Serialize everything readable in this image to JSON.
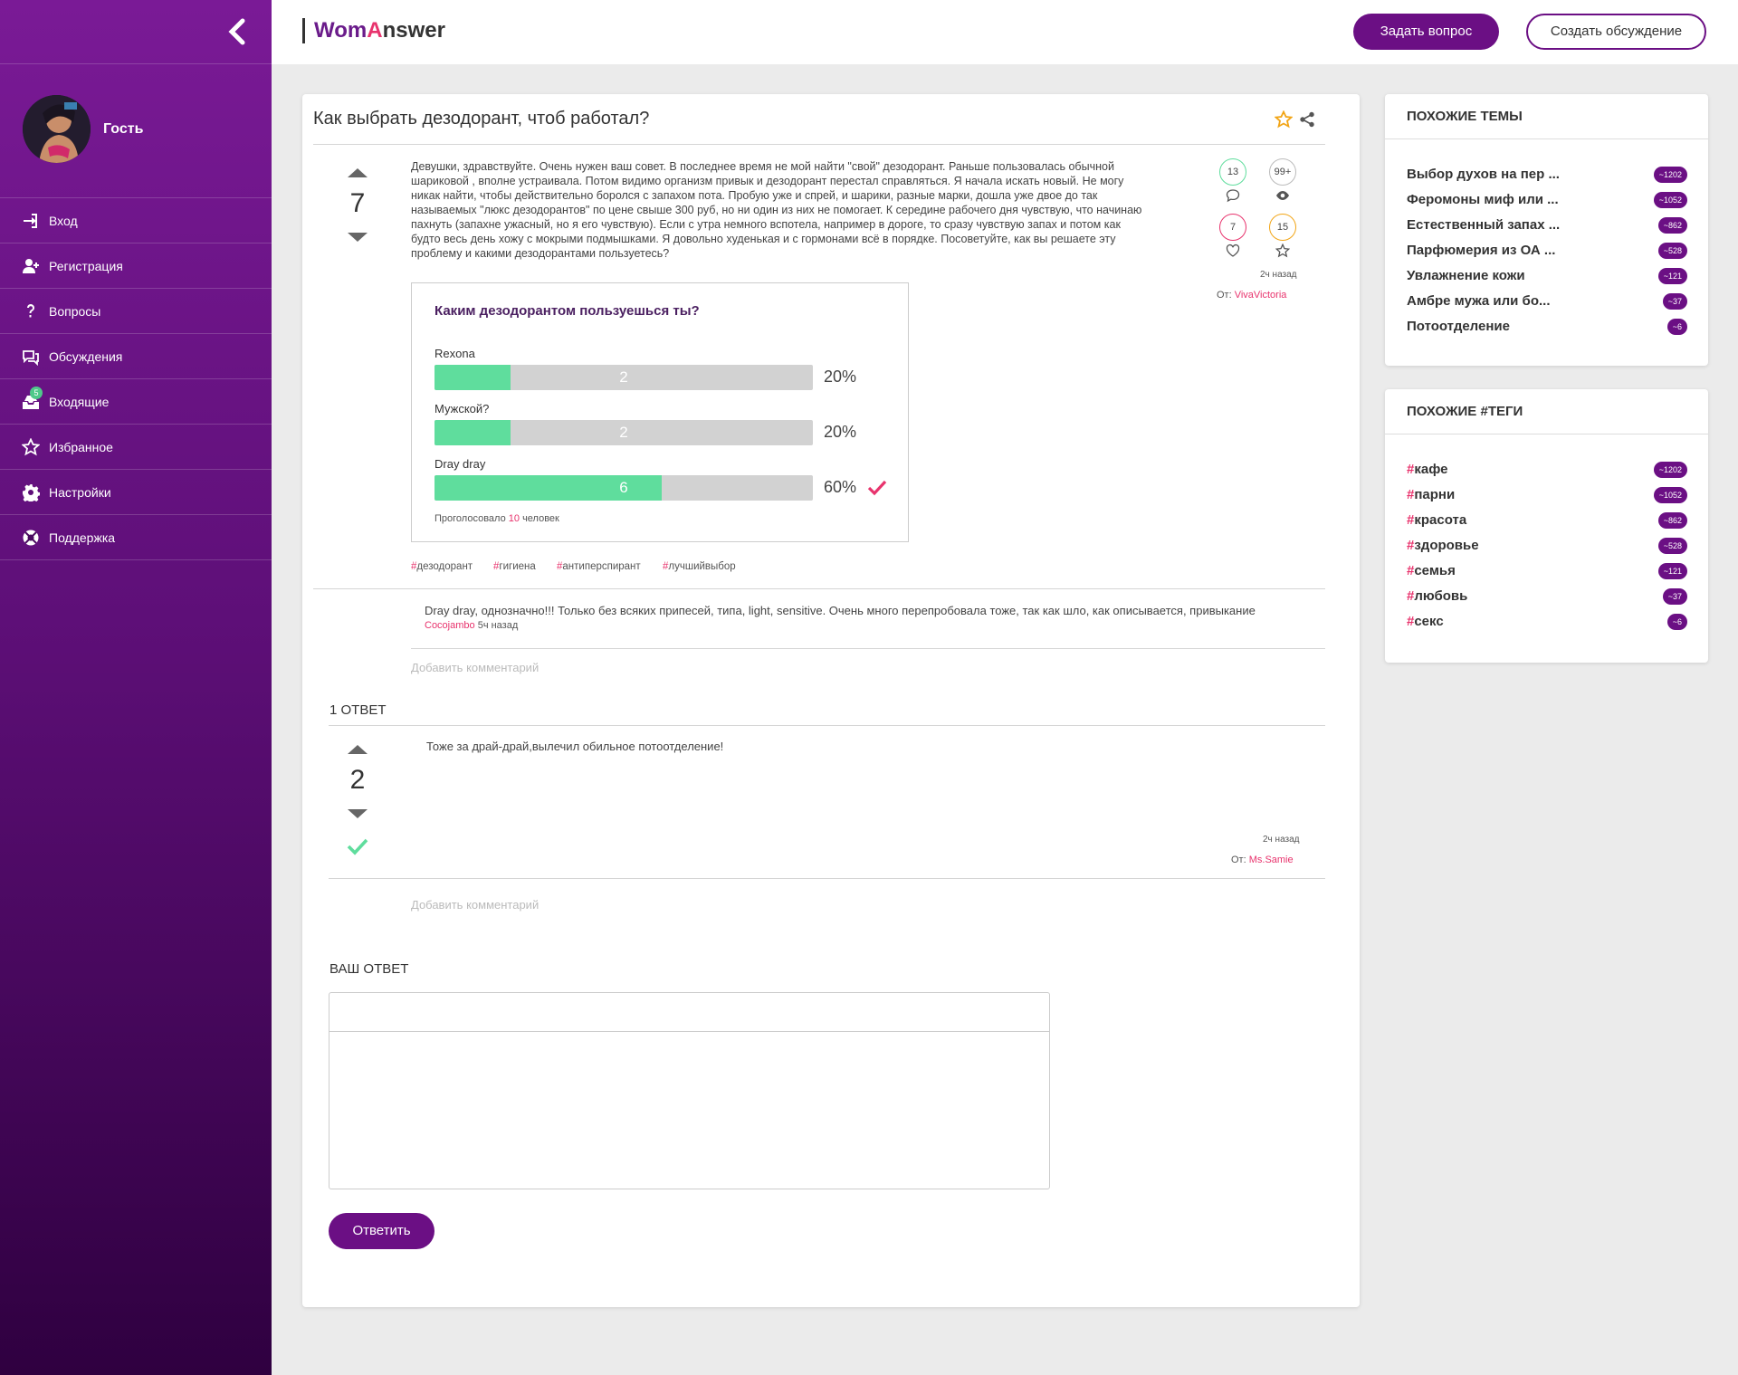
{
  "app": {
    "logo_part1": "Wom",
    "logo_part2": "A",
    "logo_part3": "nswer"
  },
  "header": {
    "ask_button": "Задать вопрос",
    "discuss_button": "Создать обсуждение"
  },
  "sidebar": {
    "user_name": "Гость",
    "items": [
      {
        "label": "Вход",
        "icon": "login-icon"
      },
      {
        "label": "Регистрация",
        "icon": "user-plus-icon"
      },
      {
        "label": "Вопросы",
        "icon": "question-icon"
      },
      {
        "label": "Обсуждения",
        "icon": "comments-icon"
      },
      {
        "label": "Входящие",
        "icon": "inbox-icon",
        "badge": "5"
      },
      {
        "label": "Избранное",
        "icon": "star-icon"
      },
      {
        "label": "Настройки",
        "icon": "gear-icon"
      },
      {
        "label": "Поддержка",
        "icon": "support-icon"
      }
    ]
  },
  "question": {
    "title": "Как выбрать дезодорант, чтоб работал?",
    "votes": "7",
    "body": "Девушки, здравствуйте. Очень нужен ваш совет. В последнее время не мой найти \"свой\" дезодорант. Раньше пользовалась обычной шариковой , вполне устраивала. Потом видимо организм привык и дезодорант перестал справляться. Я начала искать новый. Не могу никак найти, чтобы действительно боролся с запахом пота. Пробую уже и спрей, и шарики, разные марки, дошла уже двое до так называемых \"люкс дезодорантов\" по цене свыше 300 руб, но ни один из них не помогает. К середине рабочего дня чувствую, что начинаю пахнуть (запахне ужасный, но я его чувствую). Если с утра немного вспотела, например в дороге, то сразу чувствую запах и потом как будто весь день хожу с мокрыми подмышками. Я довольно худенькая и с гормонами всё в порядке. Посоветуйте, как вы решаете эту проблему и какими дезодорантами пользуетесь?",
    "stats": {
      "comments": "13",
      "views": "99+",
      "likes": "7",
      "favorites": "15"
    },
    "time": "2ч назад",
    "author_prefix": "От:",
    "author": "VivaVictoria",
    "tags": [
      "дезодорант",
      "гигиена",
      "антиперспирант",
      "лучшийвыбор"
    ]
  },
  "poll": {
    "title": "Каким дезодорантом пользуешься ты?",
    "options": [
      {
        "label": "Rexona",
        "votes": "2",
        "percent": "20%",
        "fraction": 0.2
      },
      {
        "label": "Мужской?",
        "votes": "2",
        "percent": "20%",
        "fraction": 0.2
      },
      {
        "label": "Dray dray",
        "votes": "6",
        "percent": "60%",
        "fraction": 0.6,
        "chosen": true
      }
    ],
    "footer_prefix": "Проголосовало",
    "footer_count": "10",
    "footer_suffix": "человек"
  },
  "comment": {
    "text": "Dray dray, однозначно!!! Только без всяких припесей, типа, light, sensitive. Очень много перепробовала тоже, так как шло, как описывается, привыкание",
    "author": "Cocojambo",
    "time": "5ч назад"
  },
  "add_comment": "Добавить комментарий",
  "answers_header": "1 ОТВЕТ",
  "answer": {
    "votes": "2",
    "text": "Тоже за драй-драй,вылечил обильное потоотделение!",
    "time": "2ч назад",
    "author_prefix": "От:",
    "author": "Ms.Samie"
  },
  "your_answer": {
    "title": "ВАШ ОТВЕТ",
    "submit": "Ответить"
  },
  "similar_topics": {
    "title": "ПОХОЖИЕ ТЕМЫ",
    "items": [
      {
        "label": "Выбор духов на пер ...",
        "count": "~1202"
      },
      {
        "label": "Феромоны миф или ...",
        "count": "~1052"
      },
      {
        "label": "Естественный запах ...",
        "count": "~862"
      },
      {
        "label": "Парфюмерия из ОА ...",
        "count": "~528"
      },
      {
        "label": "Увлажнение кожи",
        "count": "~121"
      },
      {
        "label": "Амбре мужа или бо...",
        "count": "~37"
      },
      {
        "label": "Потоотделение",
        "count": "~6"
      }
    ]
  },
  "similar_tags": {
    "title": "ПОХОЖИЕ #ТЕГИ",
    "items": [
      {
        "label": "кафе",
        "count": "~1202"
      },
      {
        "label": "парни",
        "count": "~1052"
      },
      {
        "label": "красота",
        "count": "~862"
      },
      {
        "label": "здоровье",
        "count": "~528"
      },
      {
        "label": "семья",
        "count": "~121"
      },
      {
        "label": "любовь",
        "count": "~37"
      },
      {
        "label": "секс",
        "count": "~6"
      }
    ]
  },
  "colors": {
    "brand": "#6b0f84",
    "accent": "#e8336d",
    "poll_fill": "#5fdd9d"
  }
}
